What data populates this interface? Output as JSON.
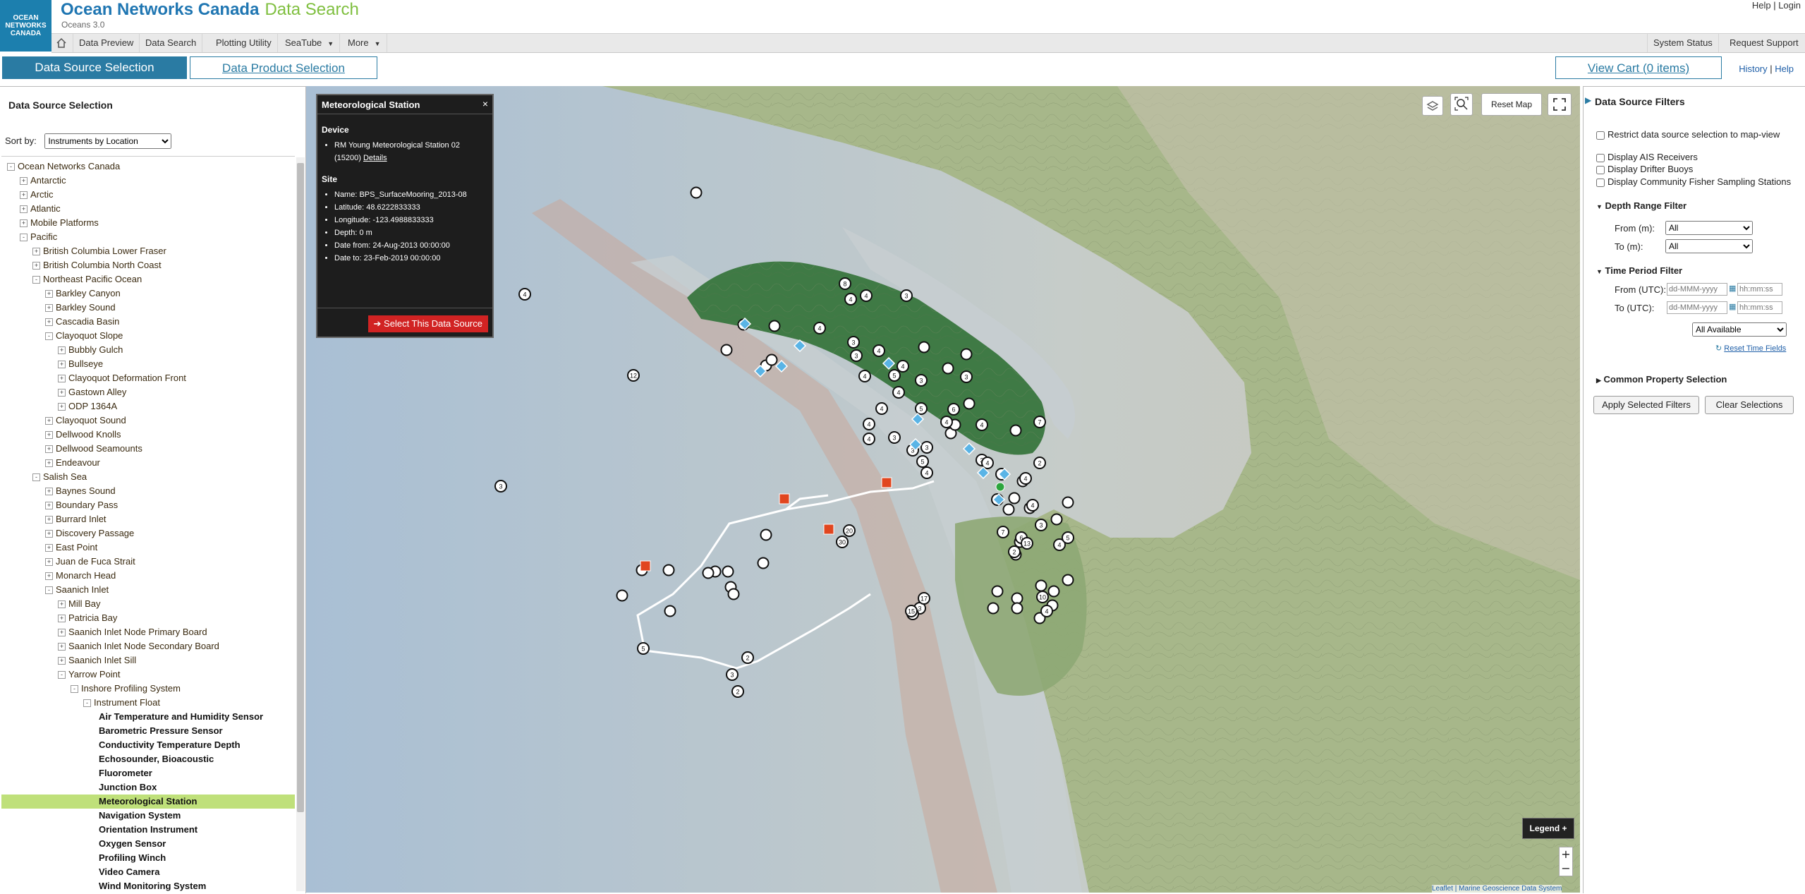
{
  "header": {
    "logo_text": "OCEAN NETWORKS CANADA",
    "title": "Ocean Networks Canada",
    "subtitle": "Data Search",
    "version": "Oceans 3.0",
    "help_link": "Help",
    "login_link": "Login"
  },
  "nav": {
    "items": [
      {
        "label": "Data Preview"
      },
      {
        "label": "Data Search"
      },
      {
        "label": "Plotting Utility"
      },
      {
        "label": "SeaTube"
      },
      {
        "label": "More"
      }
    ],
    "right_items": [
      {
        "label": "System Status"
      },
      {
        "label": "Request Support"
      }
    ]
  },
  "tabs": {
    "data_source": "Data Source Selection",
    "data_product": "Data Product Selection"
  },
  "cart": {
    "label": "View Cart (0 items)"
  },
  "history_link": "History",
  "help_link2": "Help",
  "left_panel": {
    "title": "Data Source Selection",
    "sort_label": "Sort by:",
    "sort_value": "Instruments by Location",
    "tree": [
      {
        "label": "Ocean Networks Canada",
        "level": 0,
        "toggle": "-"
      },
      {
        "label": "Antarctic",
        "level": 1,
        "toggle": "+"
      },
      {
        "label": "Arctic",
        "level": 1,
        "toggle": "+"
      },
      {
        "label": "Atlantic",
        "level": 1,
        "toggle": "+"
      },
      {
        "label": "Mobile Platforms",
        "level": 1,
        "toggle": "+"
      },
      {
        "label": "Pacific",
        "level": 1,
        "toggle": "-"
      },
      {
        "label": "British Columbia Lower Fraser",
        "level": 2,
        "toggle": "+"
      },
      {
        "label": "British Columbia North Coast",
        "level": 2,
        "toggle": "+"
      },
      {
        "label": "Northeast Pacific Ocean",
        "level": 2,
        "toggle": "-"
      },
      {
        "label": "Barkley Canyon",
        "level": 3,
        "toggle": "+"
      },
      {
        "label": "Barkley Sound",
        "level": 3,
        "toggle": "+"
      },
      {
        "label": "Cascadia Basin",
        "level": 3,
        "toggle": "+"
      },
      {
        "label": "Clayoquot Slope",
        "level": 3,
        "toggle": "-"
      },
      {
        "label": "Bubbly Gulch",
        "level": 4,
        "toggle": "+"
      },
      {
        "label": "Bullseye",
        "level": 4,
        "toggle": "+"
      },
      {
        "label": "Clayoquot Deformation Front",
        "level": 4,
        "toggle": "+"
      },
      {
        "label": "Gastown Alley",
        "level": 4,
        "toggle": "+"
      },
      {
        "label": "ODP 1364A",
        "level": 4,
        "toggle": "+"
      },
      {
        "label": "Clayoquot Sound",
        "level": 3,
        "toggle": "+"
      },
      {
        "label": "Dellwood Knolls",
        "level": 3,
        "toggle": "+"
      },
      {
        "label": "Dellwood Seamounts",
        "level": 3,
        "toggle": "+"
      },
      {
        "label": "Endeavour",
        "level": 3,
        "toggle": "+"
      },
      {
        "label": "Salish Sea",
        "level": 2,
        "toggle": "-"
      },
      {
        "label": "Baynes Sound",
        "level": 3,
        "toggle": "+"
      },
      {
        "label": "Boundary Pass",
        "level": 3,
        "toggle": "+"
      },
      {
        "label": "Burrard Inlet",
        "level": 3,
        "toggle": "+"
      },
      {
        "label": "Discovery Passage",
        "level": 3,
        "toggle": "+"
      },
      {
        "label": "East Point",
        "level": 3,
        "toggle": "+"
      },
      {
        "label": "Juan de Fuca Strait",
        "level": 3,
        "toggle": "+"
      },
      {
        "label": "Monarch Head",
        "level": 3,
        "toggle": "+"
      },
      {
        "label": "Saanich Inlet",
        "level": 3,
        "toggle": "-"
      },
      {
        "label": "Mill Bay",
        "level": 4,
        "toggle": "+"
      },
      {
        "label": "Patricia Bay",
        "level": 4,
        "toggle": "+"
      },
      {
        "label": "Saanich Inlet Node Primary Board",
        "level": 4,
        "toggle": "+"
      },
      {
        "label": "Saanich Inlet Node Secondary Board",
        "level": 4,
        "toggle": "+"
      },
      {
        "label": "Saanich Inlet Sill",
        "level": 4,
        "toggle": "+"
      },
      {
        "label": "Yarrow Point",
        "level": 4,
        "toggle": "-"
      },
      {
        "label": "Inshore Profiling System",
        "level": 5,
        "toggle": "-"
      },
      {
        "label": "Instrument Float",
        "level": 6,
        "toggle": "-"
      },
      {
        "label": "Air Temperature and Humidity Sensor",
        "level": 7,
        "leaf": true
      },
      {
        "label": "Barometric Pressure Sensor",
        "level": 7,
        "leaf": true
      },
      {
        "label": "Conductivity Temperature Depth",
        "level": 7,
        "leaf": true
      },
      {
        "label": "Echosounder, Bioacoustic",
        "level": 7,
        "leaf": true
      },
      {
        "label": "Fluorometer",
        "level": 7,
        "leaf": true
      },
      {
        "label": "Junction Box",
        "level": 7,
        "leaf": true
      },
      {
        "label": "Meteorological Station",
        "level": 7,
        "leaf": true,
        "selected": true
      },
      {
        "label": "Navigation System",
        "level": 7,
        "leaf": true
      },
      {
        "label": "Orientation Instrument",
        "level": 7,
        "leaf": true
      },
      {
        "label": "Oxygen Sensor",
        "level": 7,
        "leaf": true
      },
      {
        "label": "Profiling Winch",
        "level": 7,
        "leaf": true
      },
      {
        "label": "Video Camera",
        "level": 7,
        "leaf": true
      },
      {
        "label": "Wind Monitoring System",
        "level": 7,
        "leaf": true
      }
    ]
  },
  "popup": {
    "title": "Meteorological Station",
    "close": "×",
    "device_heading": "Device",
    "device_lines": [
      "RM Young Meteorological Station 02",
      "(15200)"
    ],
    "details_link": "Details",
    "site_heading": "Site",
    "site_lines": [
      "Name: BPS_SurfaceMooring_2013-08",
      "Latitude: 48.6222833333",
      "Longitude: -123.4988833333",
      "Depth: 0 m",
      "Date from: 24-Aug-2013 00:00:00",
      "Date to: 23-Feb-2019 00:00:00"
    ],
    "select_button": "➔ Select This Data Source"
  },
  "map": {
    "reset_label": "Reset Map",
    "legend_label": "Legend",
    "attribution": "Leaflet | Marine Geoscience Data System",
    "zoom_in": "+",
    "zoom_out": "−",
    "number_markers": [
      "4",
      "12",
      "3",
      "5",
      "8",
      "4",
      "4",
      "3",
      "4",
      "3",
      "3",
      "4",
      "4",
      "4",
      "5",
      "4",
      "3",
      "4",
      "5",
      "4",
      "3",
      "4",
      "3",
      "3",
      "6",
      "4",
      "5",
      "4",
      "3",
      "4",
      "7",
      "3",
      "4",
      "2",
      "5",
      "4",
      "3",
      "4",
      "6",
      "2",
      "3",
      "4",
      "5",
      "20",
      "30",
      "4",
      "3",
      "2",
      "2",
      "3",
      "2",
      "17",
      "15",
      "10",
      "13",
      "7"
    ],
    "colors": {
      "ocean": "#b9c3c6",
      "land": "#a8b88a",
      "accent_red": "#e1461f",
      "diamond": "#5ab4e6",
      "marker_green": "#2ca53d"
    }
  },
  "right_panel": {
    "title": "Data Source Filters",
    "restrict_label": "Restrict data source selection to map-view",
    "ais_label": "Display AIS Receivers",
    "drifter_label": "Display Drifter Buoys",
    "fisher_label": "Display Community Fisher Sampling Stations",
    "depth_heading": "Depth Range Filter",
    "depth_from_label": "From (m):",
    "depth_to_label": "To (m):",
    "depth_from_value": "All",
    "depth_to_value": "All",
    "time_heading": "Time Period Filter",
    "time_from_label": "From (UTC):",
    "time_to_label": "To (UTC):",
    "date_placeholder": "dd-MMM-yyyy",
    "time_placeholder": "hh:mm:ss",
    "availability_value": "All Available",
    "reset_time_label": "Reset Time Fields",
    "common_heading": "Common Property Selection",
    "apply_label": "Apply Selected Filters",
    "clear_label": "Clear Selections"
  }
}
